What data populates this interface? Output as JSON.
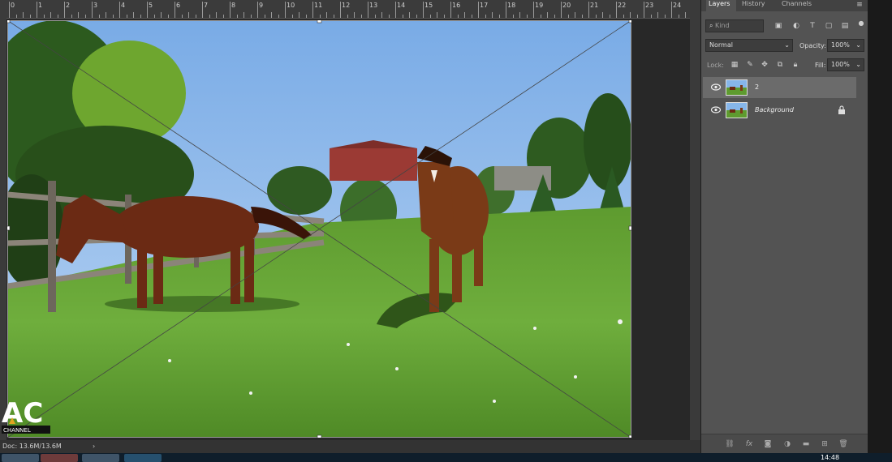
{
  "ruler": {
    "labels": [
      "0",
      "1",
      "2",
      "3",
      "4",
      "5",
      "6",
      "7",
      "8",
      "9",
      "10",
      "11",
      "12",
      "13",
      "14",
      "15",
      "16",
      "17",
      "18",
      "19",
      "20",
      "21",
      "22",
      "23",
      "24"
    ]
  },
  "status": {
    "doc_info": "Doc: 13.6M/13.6M",
    "arrow": "›"
  },
  "panel": {
    "tabs": [
      "Layers",
      "History",
      "Channels"
    ],
    "kind_placeholder": "Kind",
    "blend_mode": "Normal",
    "opacity_label": "Opacity:",
    "opacity_value": "100%",
    "lock_label": "Lock:",
    "fill_label": "Fill:",
    "fill_value": "100%",
    "layers": [
      {
        "name": "2",
        "selected": true
      },
      {
        "name": "Background",
        "selected": false,
        "locked": true
      }
    ]
  },
  "watermark": {
    "text": "AC",
    "subtext": "CHANNEL"
  },
  "taskbar": {
    "clock": "14:48"
  },
  "colors": {
    "sky": "#86b6ea",
    "grass": "#6aa43a",
    "panel": "#535353",
    "selected_layer": "#6b6b6b"
  }
}
